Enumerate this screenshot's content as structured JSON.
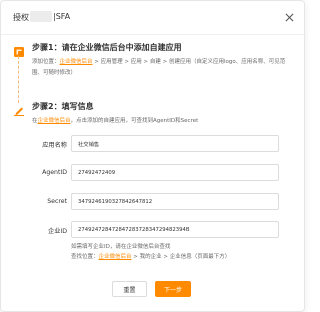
{
  "header": {
    "title_prefix": "授权",
    "title_suffix": "|SFA"
  },
  "step1": {
    "title": "步骤1：请在企业微信后台中添加自建应用",
    "desc_prefix": "添加位置：",
    "desc_link": "企业微信后台",
    "desc_suffix": " > 应用管理 > 应用 > 自建 > 创建应用（自定义应用logo、应用名称、可见范围、可随时修改）"
  },
  "step2": {
    "title": "步骤2：填写信息",
    "desc_prefix": "在",
    "desc_link": "企业微信后台",
    "desc_suffix": "，点击添加的自建应用，可查找到AgentID和Secret"
  },
  "form": {
    "app_name_label": "应用名称",
    "app_name_value": "社交销售",
    "agentid_label": "AgentID",
    "agentid_value": "27492472409",
    "secret_label": "Secret",
    "secret_value": "3479246190327842647812",
    "corpid_label": "企业ID",
    "corpid_value": "27492472847284728372834729482394B"
  },
  "corp_hint": {
    "line1": "如需填写企业ID，请在企业微信后台查找",
    "line2_prefix": "查找位置：",
    "line2_link": "企业微信后台",
    "line2_suffix": " > 我的企业 > 企业信息（页面最下方）"
  },
  "buttons": {
    "reset": "重置",
    "next": "下一步"
  },
  "colors": {
    "accent": "#ff8a00"
  },
  "icons": {
    "close": "close-icon",
    "step1": "plus-square-icon",
    "step2": "pencil-icon"
  }
}
